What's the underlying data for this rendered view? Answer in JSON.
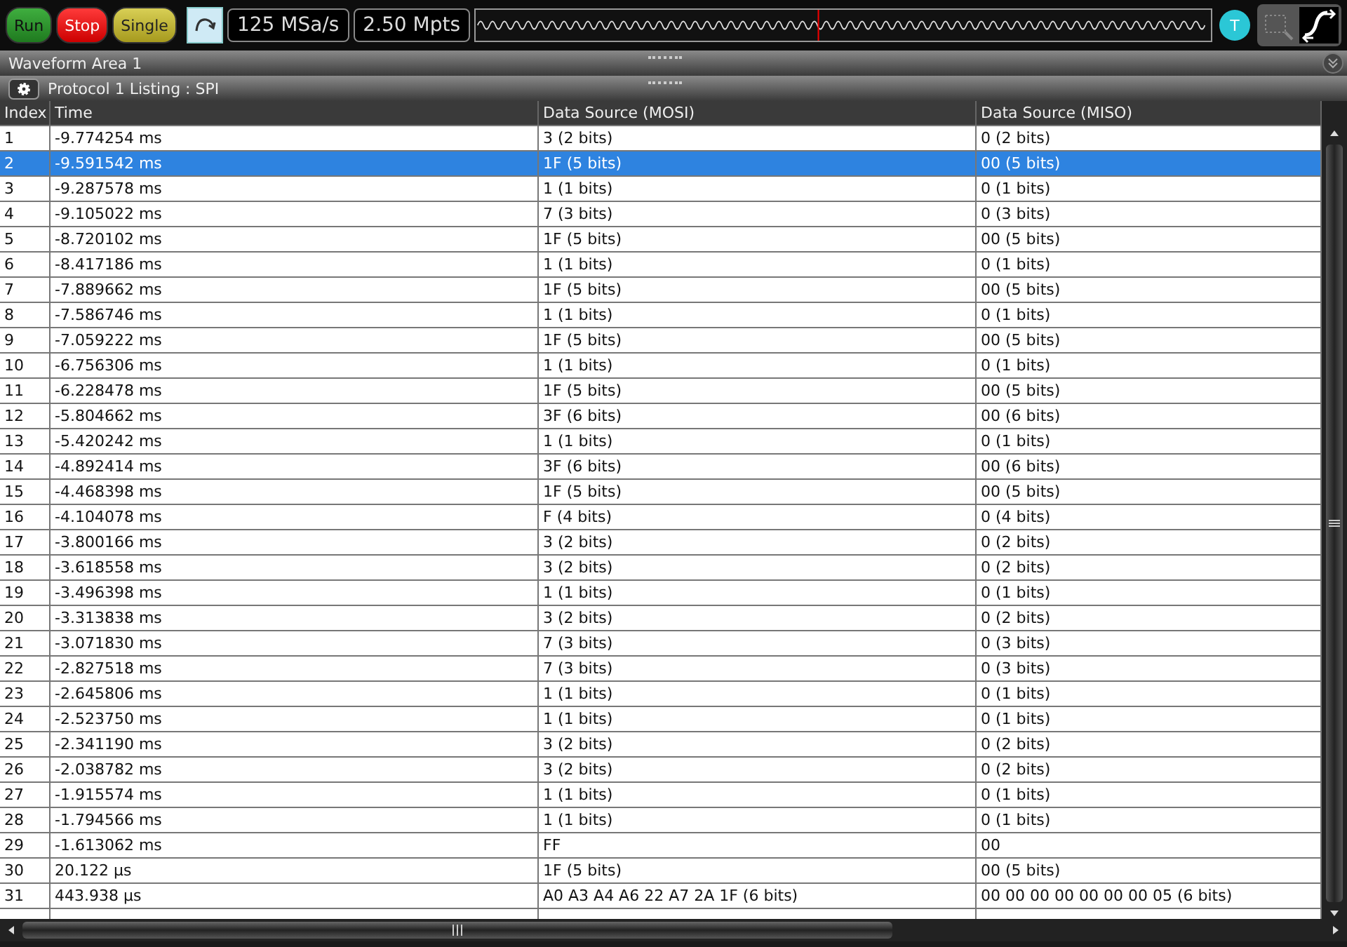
{
  "toolbar": {
    "buttons": [
      {
        "label": "Run",
        "kind": "run"
      },
      {
        "label": "Stop",
        "kind": "stop"
      },
      {
        "label": "Single",
        "kind": "single"
      }
    ],
    "sample_rate": "125 MSa/s",
    "memory_depth": "2.50 Mpts",
    "trigger_badge": "T",
    "modes": [
      {
        "kind": "zoom",
        "selected": false
      },
      {
        "kind": "waveform",
        "selected": true
      }
    ]
  },
  "waveform_area": {
    "title": "Waveform Area 1"
  },
  "listing": {
    "title": "Protocol 1 Listing : SPI",
    "columns": [
      "Index",
      "Time",
      "Data Source (MOSI)",
      "Data Source (MISO)"
    ],
    "rows": [
      {
        "cells": [
          "1",
          "-9.774254 ms",
          "3 (2 bits)",
          "0 (2 bits)"
        ],
        "selected": false
      },
      {
        "cells": [
          "2",
          "-9.591542 ms",
          "1F (5 bits)",
          "00 (5 bits)"
        ],
        "selected": true
      },
      {
        "cells": [
          "3",
          "-9.287578 ms",
          "1 (1 bits)",
          "0 (1 bits)"
        ],
        "selected": false
      },
      {
        "cells": [
          "4",
          "-9.105022 ms",
          "7 (3 bits)",
          "0 (3 bits)"
        ],
        "selected": false
      },
      {
        "cells": [
          "5",
          "-8.720102 ms",
          "1F (5 bits)",
          "00 (5 bits)"
        ],
        "selected": false
      },
      {
        "cells": [
          "6",
          "-8.417186 ms",
          "1 (1 bits)",
          "0 (1 bits)"
        ],
        "selected": false
      },
      {
        "cells": [
          "7",
          "-7.889662 ms",
          "1F (5 bits)",
          "00 (5 bits)"
        ],
        "selected": false
      },
      {
        "cells": [
          "8",
          "-7.586746 ms",
          "1 (1 bits)",
          "0 (1 bits)"
        ],
        "selected": false
      },
      {
        "cells": [
          "9",
          "-7.059222 ms",
          "1F (5 bits)",
          "00 (5 bits)"
        ],
        "selected": false
      },
      {
        "cells": [
          "10",
          "-6.756306 ms",
          "1 (1 bits)",
          "0 (1 bits)"
        ],
        "selected": false
      },
      {
        "cells": [
          "11",
          "-6.228478 ms",
          "1F (5 bits)",
          "00 (5 bits)"
        ],
        "selected": false
      },
      {
        "cells": [
          "12",
          "-5.804662 ms",
          "3F (6 bits)",
          "00 (6 bits)"
        ],
        "selected": false
      },
      {
        "cells": [
          "13",
          "-5.420242 ms",
          "1 (1 bits)",
          "0 (1 bits)"
        ],
        "selected": false
      },
      {
        "cells": [
          "14",
          "-4.892414 ms",
          "3F (6 bits)",
          "00 (6 bits)"
        ],
        "selected": false
      },
      {
        "cells": [
          "15",
          "-4.468398 ms",
          "1F (5 bits)",
          "00 (5 bits)"
        ],
        "selected": false
      },
      {
        "cells": [
          "16",
          "-4.104078 ms",
          "F (4 bits)",
          "0 (4 bits)"
        ],
        "selected": false
      },
      {
        "cells": [
          "17",
          "-3.800166 ms",
          "3 (2 bits)",
          "0 (2 bits)"
        ],
        "selected": false
      },
      {
        "cells": [
          "18",
          "-3.618558 ms",
          "3 (2 bits)",
          "0 (2 bits)"
        ],
        "selected": false
      },
      {
        "cells": [
          "19",
          "-3.496398 ms",
          "1 (1 bits)",
          "0 (1 bits)"
        ],
        "selected": false
      },
      {
        "cells": [
          "20",
          "-3.313838 ms",
          "3 (2 bits)",
          "0 (2 bits)"
        ],
        "selected": false
      },
      {
        "cells": [
          "21",
          "-3.071830 ms",
          "7 (3 bits)",
          "0 (3 bits)"
        ],
        "selected": false
      },
      {
        "cells": [
          "22",
          "-2.827518 ms",
          "7 (3 bits)",
          "0 (3 bits)"
        ],
        "selected": false
      },
      {
        "cells": [
          "23",
          "-2.645806 ms",
          "1 (1 bits)",
          "0 (1 bits)"
        ],
        "selected": false
      },
      {
        "cells": [
          "24",
          "-2.523750 ms",
          "1 (1 bits)",
          "0 (1 bits)"
        ],
        "selected": false
      },
      {
        "cells": [
          "25",
          "-2.341190 ms",
          "3 (2 bits)",
          "0 (2 bits)"
        ],
        "selected": false
      },
      {
        "cells": [
          "26",
          "-2.038782 ms",
          "3 (2 bits)",
          "0 (2 bits)"
        ],
        "selected": false
      },
      {
        "cells": [
          "27",
          "-1.915574 ms",
          "1 (1 bits)",
          "0 (1 bits)"
        ],
        "selected": false
      },
      {
        "cells": [
          "28",
          "-1.794566 ms",
          "1 (1 bits)",
          "0 (1 bits)"
        ],
        "selected": false
      },
      {
        "cells": [
          "29",
          "-1.613062 ms",
          "FF",
          "00"
        ],
        "selected": false
      },
      {
        "cells": [
          "30",
          "20.122 µs",
          "1F (5 bits)",
          "00 (5 bits)"
        ],
        "selected": false
      },
      {
        "cells": [
          "31",
          "443.938 µs",
          "A0 A3 A4 A6 22 A7 2A 1F (6 bits)",
          "00 00 00 00 00 00 00 05 (6 bits)"
        ],
        "selected": false
      }
    ]
  }
}
